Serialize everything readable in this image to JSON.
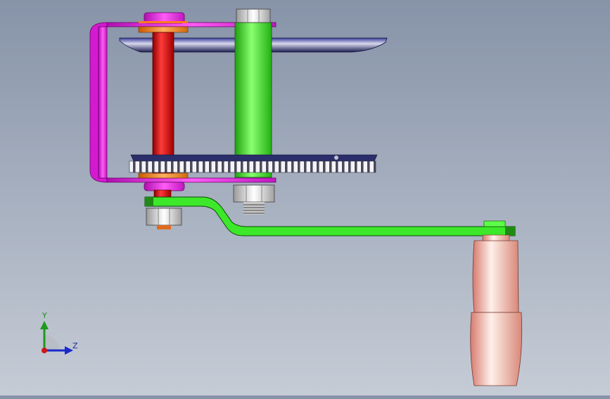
{
  "viewport": {
    "background_top": "#8793a8",
    "background_bottom": "#c6ccd6"
  },
  "model": {
    "parts": [
      {
        "name": "frame-bracket",
        "color": "#e81ee0"
      },
      {
        "name": "top-plate",
        "color": "#2a2e7a"
      },
      {
        "name": "red-shaft",
        "color": "#e81212"
      },
      {
        "name": "green-shaft",
        "color": "#34e51e"
      },
      {
        "name": "spur-gear",
        "color": "#dcdce6"
      },
      {
        "name": "crank-arm",
        "color": "#2ee41e"
      },
      {
        "name": "handle-grip",
        "color": "#f2b8a8"
      },
      {
        "name": "hex-nut",
        "color": "#eeeeee"
      },
      {
        "name": "washer",
        "color": "#ee8a1a"
      }
    ]
  },
  "triad": {
    "y_label": "Y",
    "z_label": "Z",
    "y_color": "#1c9a1c",
    "z_color": "#1a2acc",
    "x_color": "#d01818"
  }
}
